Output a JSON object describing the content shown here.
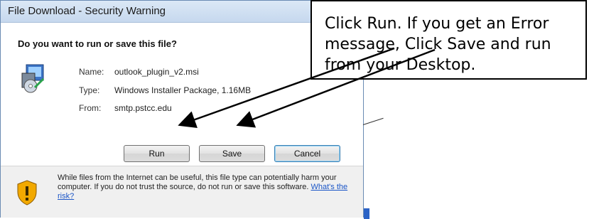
{
  "dialog": {
    "title": "File Download - Security Warning",
    "question": "Do you want to run or save this file?",
    "file_icon": "installer-package-icon",
    "fields": {
      "name_label": "Name:",
      "name_value": "outlook_plugin_v2.msi",
      "type_label": "Type:",
      "type_value": "Windows Installer Package, 1.16MB",
      "from_label": "From:",
      "from_value": "smtp.pstcc.edu"
    },
    "buttons": {
      "run": "Run",
      "save": "Save",
      "cancel": "Cancel"
    },
    "footer": {
      "icon": "shield-warning-icon",
      "text": "While files from the Internet can be useful, this file type can potentially harm your computer. If you do not trust the source, do not run or save this software.",
      "link": "What's the risk?"
    }
  },
  "callout": {
    "text": "Click Run. If you get an Error message, Click Save and run from your Desktop."
  },
  "colors": {
    "titlebar": "#c6d8ee",
    "link": "#1a55c7",
    "shield": "#f2a900"
  }
}
